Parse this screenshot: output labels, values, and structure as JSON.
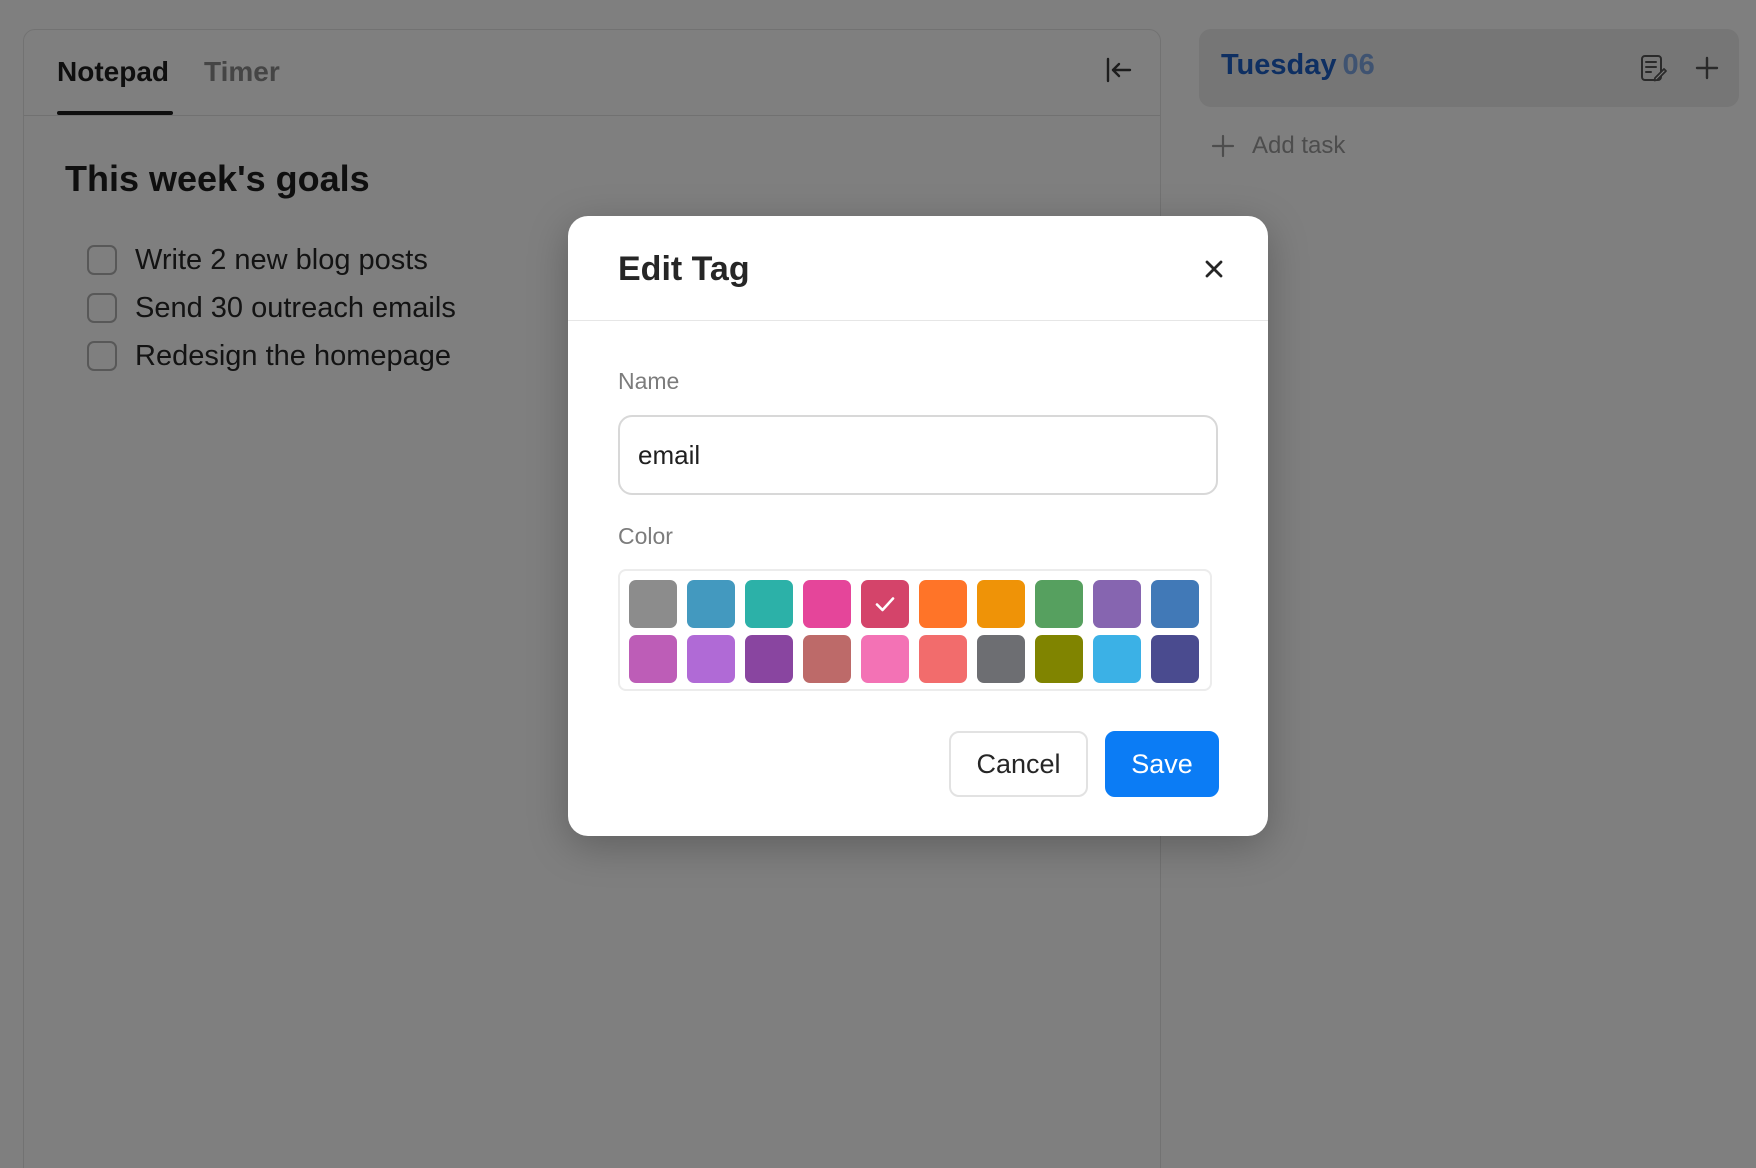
{
  "notepad": {
    "tabs": [
      {
        "label": "Notepad",
        "active": true
      },
      {
        "label": "Timer",
        "active": false
      }
    ],
    "collapse_icon": "collapse-left-icon",
    "goals_title": "This week's goals",
    "goals": [
      {
        "text": "Write 2 new blog posts",
        "checked": false
      },
      {
        "text": "Send 30 outreach emails",
        "checked": false
      },
      {
        "text": "Redesign the homepage",
        "checked": false
      }
    ]
  },
  "day_panel": {
    "day_name": "Tuesday",
    "day_number": "06",
    "add_task_label": "Add task"
  },
  "modal": {
    "title": "Edit Tag",
    "name_label": "Name",
    "name_value": "email",
    "color_label": "Color",
    "colors": [
      "#8c8c8c",
      "#4399bf",
      "#2cb1a8",
      "#e5459a",
      "#d4446a",
      "#ff7428",
      "#ef9307",
      "#56a05f",
      "#8665b0",
      "#4179b7",
      "#bd5db7",
      "#b06ad6",
      "#8945a0",
      "#bd6a69",
      "#f372b5",
      "#f26c6c",
      "#6d6e72",
      "#808400",
      "#3bb1e6",
      "#4a4b8f"
    ],
    "selected_color": "#d4446a",
    "cancel_label": "Cancel",
    "save_label": "Save"
  }
}
